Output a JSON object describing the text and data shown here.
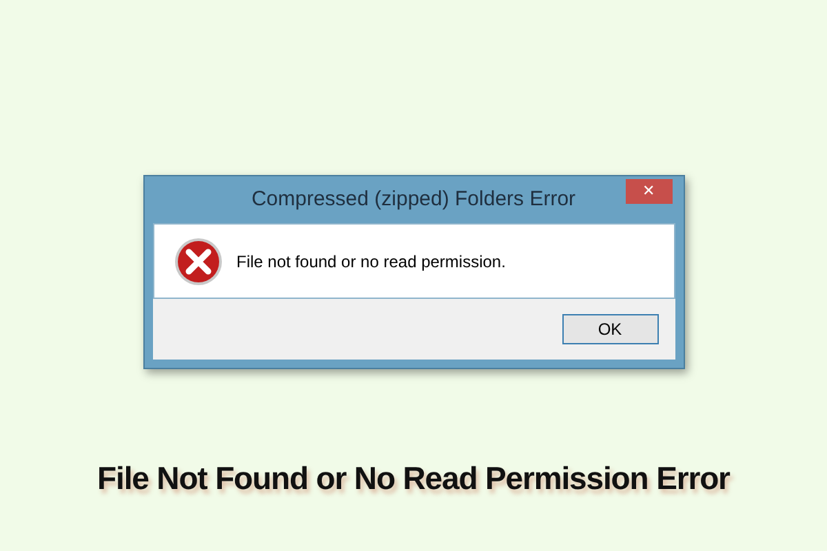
{
  "dialog": {
    "title": "Compressed (zipped) Folders Error",
    "close_button": "✕",
    "message": "File not found or no read permission.",
    "buttons": [
      "OK"
    ]
  },
  "caption": "File Not Found or No Read Permission Error"
}
